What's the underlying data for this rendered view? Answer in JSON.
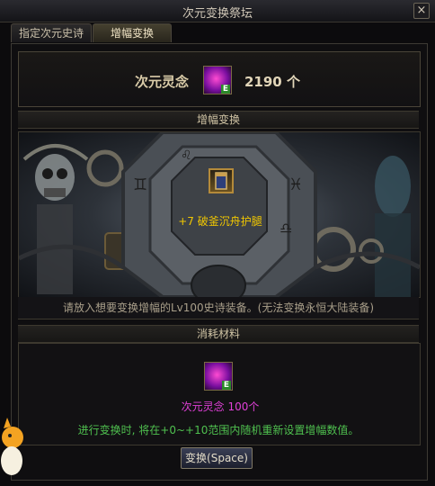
{
  "window": {
    "title": "次元变换祭坛",
    "close_label": "×"
  },
  "tabs": [
    {
      "label": "指定次元史诗"
    },
    {
      "label": "增幅变换"
    }
  ],
  "resource": {
    "name": "次元灵念",
    "count": "2190 个",
    "item_badge": "E"
  },
  "transform_section": {
    "header": "增幅变换",
    "item_name": "+7 破釜沉舟护腿",
    "hint": "请放入想要变换增幅的Lv100史诗装备。(无法变换永恒大陆装备)"
  },
  "materials_section": {
    "header": "消耗材料",
    "material_name": "次元灵念 100个",
    "item_badge": "E",
    "note": "进行变换时, 将在+0~+10范围内随机重新设置增幅数值。"
  },
  "action_button": "变换(Space)",
  "colors": {
    "item_name": "#f2c800",
    "material_name": "#e040d8",
    "note": "#4fc04f"
  }
}
